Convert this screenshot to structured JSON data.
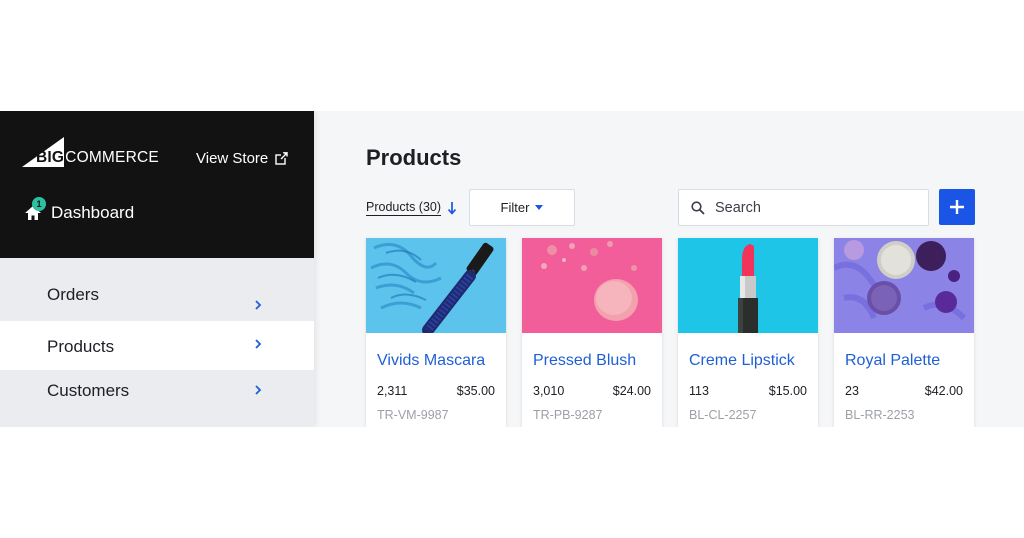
{
  "brand": {
    "logo_big": "BIG",
    "logo_rest": "COMMERCE"
  },
  "header": {
    "view_store_label": "View Store"
  },
  "dashboard": {
    "label": "Dashboard",
    "badge_count": "1"
  },
  "sidebar": {
    "items": [
      {
        "label": "Orders"
      },
      {
        "label": "Products"
      },
      {
        "label": "Customers"
      }
    ]
  },
  "main": {
    "title": "Products",
    "sort_label": "Products (30)",
    "filter_label": "Filter",
    "search_placeholder": "Search"
  },
  "colors": {
    "accent": "#1a55e6",
    "link": "#1f5fd6",
    "sidebar_top": "#121212",
    "badge": "#2bc0a0"
  },
  "products": [
    {
      "name": "Vivids Mascara",
      "qty": "2,311",
      "price": "$35.00",
      "sku": "TR-VM-9987",
      "image": "mascara-brush",
      "bg": "#5cc4ec"
    },
    {
      "name": "Pressed Blush",
      "qty": "3,010",
      "price": "$24.00",
      "sku": "TR-PB-9287",
      "image": "crushed-blush",
      "bg": "#f25e99"
    },
    {
      "name": "Creme Lipstick",
      "qty": "113",
      "price": "$15.00",
      "sku": "BL-CL-2257",
      "image": "red-lipstick",
      "bg": "#1ec5e6"
    },
    {
      "name": "Royal Palette",
      "qty": "23",
      "price": "$42.00",
      "sku": "BL-RR-2253",
      "image": "eyeshadow-palette",
      "bg": "#8b84e6"
    }
  ]
}
